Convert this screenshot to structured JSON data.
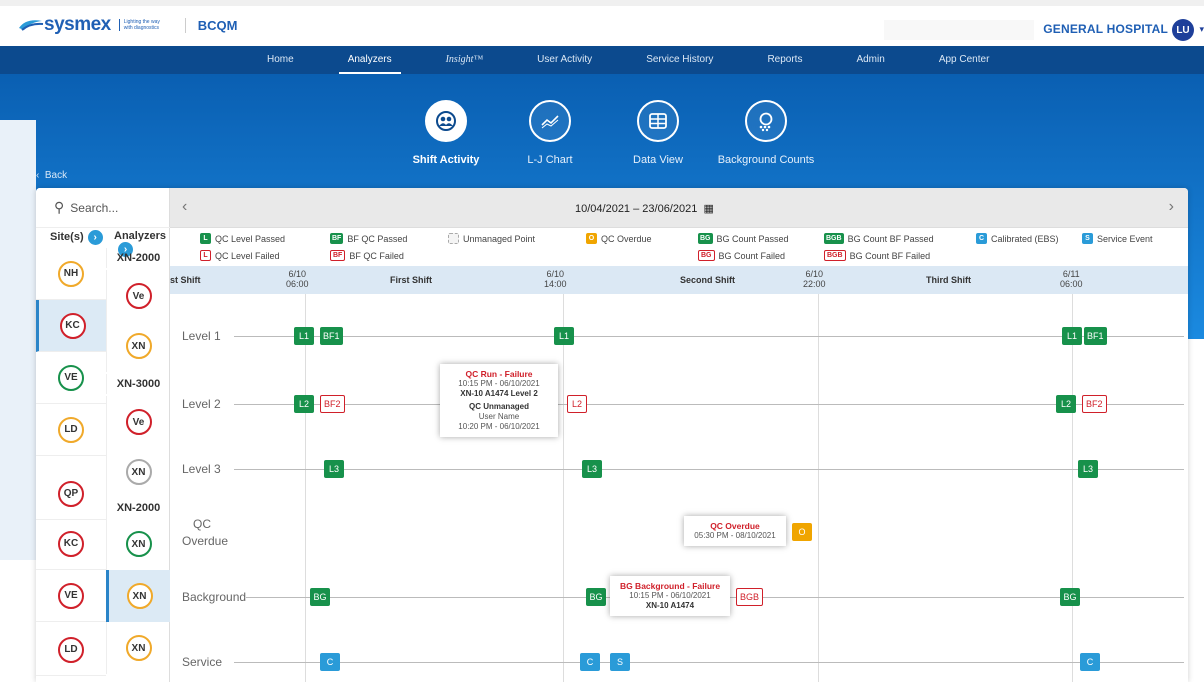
{
  "header": {
    "brand": "sysmex",
    "tagline": "Lighting the way with diagnostics",
    "app": "BCQM",
    "hospital": "GENERAL HOSPITAL",
    "user_initials": "LU"
  },
  "nav": {
    "items": [
      "Home",
      "Analyzers",
      "Insight™",
      "User Activity",
      "Service History",
      "Reports",
      "Admin",
      "App Center"
    ],
    "active": "Analyzers"
  },
  "tools": [
    {
      "label": "Shift Activity",
      "icon": "people-cycle-icon",
      "active": true
    },
    {
      "label": "L-J Chart",
      "icon": "line-chart-icon",
      "active": false
    },
    {
      "label": "Data View",
      "icon": "table-icon",
      "active": false
    },
    {
      "label": "Background Counts",
      "icon": "search-dots-icon",
      "active": false
    }
  ],
  "back_label": "Back",
  "search_placeholder": "Search...",
  "sites_header": "Site(s)",
  "analyzers_header": "Analyzers",
  "sites": [
    "NH",
    "KC",
    "VE",
    "LD",
    "QP",
    "KC",
    "VE",
    "LD"
  ],
  "analyzer_groups": [
    "XN-2000",
    "XN-3000",
    "XN-2000"
  ],
  "analyzers": [
    "Ve",
    "XN",
    "Ve",
    "XN",
    "XN",
    "XN",
    "XN"
  ],
  "date_range": "10/04/2021 – 23/06/2021",
  "legend": [
    {
      "chip": "L",
      "label": "QC Level Passed",
      "style": "g"
    },
    {
      "chip": "L",
      "label": "QC Level Failed",
      "style": "r"
    },
    {
      "chip": "BF",
      "label": "BF QC Passed",
      "style": "g"
    },
    {
      "chip": "BF",
      "label": "BF QC Failed",
      "style": "r"
    },
    {
      "chip": "",
      "label": "Unmanaged Point",
      "style": "u"
    },
    {
      "chip": "O",
      "label": "QC Overdue",
      "style": "o"
    },
    {
      "chip": "BG",
      "label": "BG Count Passed",
      "style": "g"
    },
    {
      "chip": "BG",
      "label": "BG Count Failed",
      "style": "r"
    },
    {
      "chip": "BGB",
      "label": "BG Count BF Passed",
      "style": "g"
    },
    {
      "chip": "BGB",
      "label": "BG Count BF Failed",
      "style": "r"
    },
    {
      "chip": "C",
      "label": "Calibrated (EBS)",
      "style": "b"
    },
    {
      "chip": "S",
      "label": "Service Event",
      "style": "b"
    }
  ],
  "shifts": [
    "st Shift",
    "First Shift",
    "Second Shift",
    "Third Shift"
  ],
  "ticks": [
    {
      "date": "6/10",
      "time": "06:00"
    },
    {
      "date": "6/10",
      "time": "14:00"
    },
    {
      "date": "6/10",
      "time": "22:00"
    },
    {
      "date": "6/11",
      "time": "06:00"
    }
  ],
  "rows": [
    "Level 1",
    "Level 2",
    "Level 3",
    "QC\nOverdue",
    "Background",
    "Service"
  ],
  "points": {
    "level1": [
      "L1",
      "BF1",
      "L1",
      "L1",
      "BF1"
    ],
    "level2": [
      "L2",
      "BF2",
      "L2",
      "L2",
      "BF2"
    ],
    "level3": [
      "L3",
      "L3",
      "L3"
    ],
    "overdue": [
      "O"
    ],
    "background": [
      "BG",
      "BG",
      "BGB",
      "BG"
    ],
    "service": [
      "C",
      "C",
      "S",
      "C"
    ]
  },
  "tooltips": {
    "qc_run": {
      "title": "QC Run - Failure",
      "line1": "10:15 PM - 06/10/2021",
      "line2": "XN-10 A1474 Level 2",
      "line3": "QC Unmanaged",
      "line4": "User Name",
      "line5": "10:20 PM - 06/10/2021"
    },
    "qc_overdue": {
      "title": "QC Overdue",
      "line1": "05:30 PM - 08/10/2021"
    },
    "bg": {
      "title": "BG Background - Failure",
      "line1": "10:15 PM - 06/10/2021",
      "line2": "XN-10 A1474"
    }
  },
  "colors": {
    "nav": "#0c4a8e",
    "hero": "#1b8ae0",
    "pass": "#17914b",
    "fail": "#d0202a",
    "overdue": "#f0a500",
    "service": "#2a9bd8"
  }
}
